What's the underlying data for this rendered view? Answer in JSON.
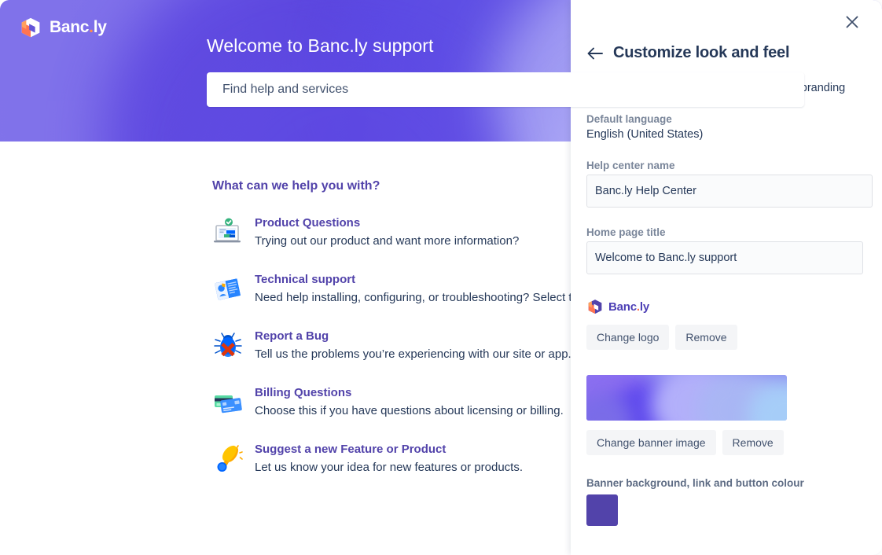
{
  "brand": {
    "logo_name": "Banc",
    "logo_dot": ".",
    "logo_suffix": "ly",
    "logo_icon": "bancly-cube-logo",
    "accent_color": "#5243aa",
    "logo_orange": "#ff7452"
  },
  "helpcenter": {
    "banner_title": "Welcome to Banc.ly support",
    "search_placeholder": "Find help and services",
    "content_heading": "What can we help you with?",
    "topics": [
      {
        "icon": "laptop-check-icon",
        "title": "Product Questions",
        "desc": "Trying out our product and want more information?"
      },
      {
        "icon": "manual-book-icon",
        "title": "Technical support",
        "desc": "Need help installing, configuring, or troubleshooting? Select this topic"
      },
      {
        "icon": "bug-icon",
        "title": "Report a Bug",
        "desc": "Tell us the problems you’re experiencing with our site or app."
      },
      {
        "icon": "credit-cards-icon",
        "title": "Billing Questions",
        "desc": "Choose this if you have questions about licensing or billing."
      },
      {
        "icon": "lightbulb-idea-icon",
        "title": "Suggest a new Feature or Product",
        "desc": "Let us know your idea for new features or products."
      }
    ]
  },
  "panel": {
    "close_icon": "close-icon",
    "back_icon": "arrow-left-icon",
    "title": "Customize look and feel",
    "subtitle": "Match your help center to your company's branding",
    "default_language_label": "Default language",
    "default_language_value": "English (United States)",
    "help_center_name_label": "Help center name",
    "help_center_name_value": "Banc.ly Help Center",
    "home_page_title_label": "Home page title",
    "home_page_title_value": "Welcome to Banc.ly support",
    "logo_preview_alt": "Banc.ly",
    "change_logo_label": "Change logo",
    "remove_logo_label": "Remove",
    "change_banner_label": "Change banner image",
    "remove_banner_label": "Remove",
    "banner_colour_label": "Banner background, link and button colour",
    "banner_colour_value": "#5243aa"
  }
}
